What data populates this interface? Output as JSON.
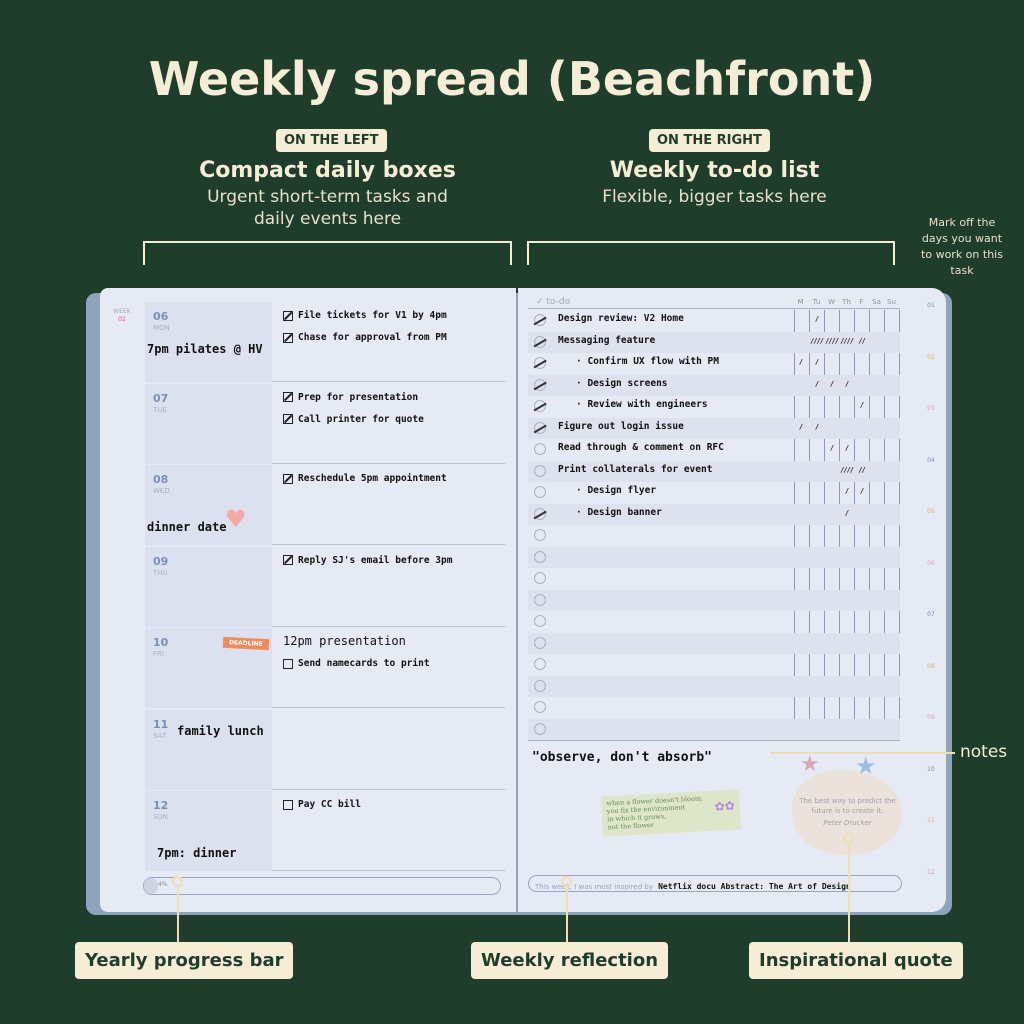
{
  "title": "Weekly spread (Beachfront)",
  "left_section": {
    "badge": "ON THE LEFT",
    "heading": "Compact daily boxes",
    "sub_1": "Urgent short-term tasks and",
    "sub_2": "daily events here"
  },
  "right_section": {
    "badge": "ON THE RIGHT",
    "heading": "Weekly to-do list",
    "sub": "Flexible, bigger tasks here"
  },
  "annotation_days": [
    "Mark off the",
    "days you want",
    "to work on this",
    "task"
  ],
  "week": {
    "label": "WEEK",
    "num": "02"
  },
  "days": [
    {
      "num": "06",
      "name": "MON",
      "note": "7pm pilates @ HV",
      "tasks": [
        {
          "text": "File tickets for V1 by 4pm",
          "done": true
        },
        {
          "text": "Chase for approval from PM",
          "done": true
        }
      ]
    },
    {
      "num": "07",
      "name": "TUE",
      "note": "",
      "tasks": [
        {
          "text": "Prep for presentation",
          "done": true
        },
        {
          "text": "Call printer for quote",
          "done": true
        }
      ]
    },
    {
      "num": "08",
      "name": "WED",
      "note": "dinner date",
      "tasks": [
        {
          "text": "Reschedule 5pm appointment",
          "done": true
        }
      ]
    },
    {
      "num": "09",
      "name": "THU",
      "note": "",
      "tasks": [
        {
          "text": "Reply SJ's email before 3pm",
          "done": true
        }
      ]
    },
    {
      "num": "10",
      "name": "FRI",
      "note": "",
      "sticker": "DEADLINE",
      "event": "12pm presentation",
      "tasks": [
        {
          "text": "Send namecards to print",
          "done": false
        }
      ]
    },
    {
      "num": "11",
      "name": "SAT",
      "note": "family lunch",
      "tasks": []
    },
    {
      "num": "12",
      "name": "SUN",
      "note": "7pm: dinner",
      "tasks": [
        {
          "text": "Pay CC bill",
          "done": false
        }
      ]
    }
  ],
  "progress": {
    "label": "4%",
    "value": 0.04
  },
  "todo": {
    "header": "to-do",
    "days": [
      "M",
      "Tu",
      "W",
      "Th",
      "F",
      "Sa",
      "Su"
    ],
    "items": [
      {
        "text": "Design review: V2 Home",
        "done": true,
        "indent": false,
        "marks": [
          "",
          "/",
          "",
          "",
          "",
          "",
          ""
        ]
      },
      {
        "text": "Messaging feature",
        "done": true,
        "indent": false,
        "marks": [
          "",
          "////",
          "////",
          "////",
          "//",
          "",
          ""
        ]
      },
      {
        "text": "· Confirm UX flow with PM",
        "done": true,
        "indent": true,
        "marks": [
          "/",
          "/",
          "",
          "",
          "",
          "",
          ""
        ]
      },
      {
        "text": "· Design screens",
        "done": true,
        "indent": true,
        "marks": [
          "",
          "/",
          "/",
          "/",
          "",
          "",
          ""
        ]
      },
      {
        "text": "· Review with engineers",
        "done": true,
        "indent": true,
        "marks": [
          "",
          "",
          "",
          "",
          "/",
          "",
          ""
        ]
      },
      {
        "text": "Figure out login issue",
        "done": true,
        "indent": false,
        "marks": [
          "/",
          "/",
          "",
          "",
          "",
          "",
          ""
        ]
      },
      {
        "text": "Read through & comment on RFC",
        "done": false,
        "indent": false,
        "marks": [
          "",
          "",
          "/",
          "/",
          "",
          "",
          ""
        ]
      },
      {
        "text": "Print collaterals for event",
        "done": false,
        "indent": false,
        "marks": [
          "",
          "",
          "",
          "////",
          "//",
          "",
          ""
        ]
      },
      {
        "text": "· Design flyer",
        "done": false,
        "indent": true,
        "marks": [
          "",
          "",
          "",
          "/",
          "/",
          "",
          ""
        ]
      },
      {
        "text": "· Design banner",
        "done": true,
        "indent": true,
        "marks": [
          "",
          "",
          "",
          "/",
          "",
          "",
          ""
        ]
      }
    ],
    "empty_rows": 10
  },
  "notes": {
    "text": "\"observe, don't absorb\"",
    "sticker": [
      "when a flower doesn't bloom,",
      "you fix the environment",
      "in which it grows,",
      "not the flower"
    ]
  },
  "quote": {
    "text_1": "The best way to predict the",
    "text_2": "future is to create it.",
    "author": "Peter Drucker"
  },
  "reflection": {
    "prompt": "This week, I was most inspired by",
    "answer": "Netflix docu Abstract: The Art of Design"
  },
  "month_tabs": [
    "01",
    "02",
    "03",
    "04",
    "05",
    "06",
    "07",
    "08",
    "09",
    "10",
    "11",
    "12"
  ],
  "callouts": {
    "notes": "notes",
    "progress": "Yearly progress bar",
    "reflection": "Weekly reflection",
    "quote": "Inspirational quote"
  },
  "colors": {
    "background": "#1f3d2b",
    "cream": "#f6edd6",
    "deadline": "#f28a5c",
    "heart": "#f4a9a8"
  }
}
